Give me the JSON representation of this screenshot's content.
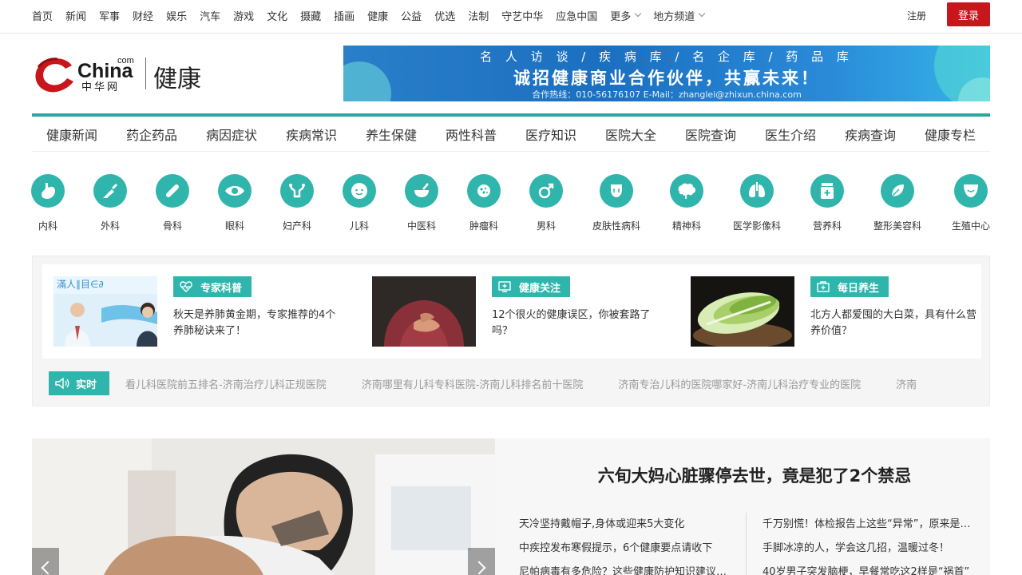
{
  "topnav": {
    "links": [
      "首页",
      "新闻",
      "军事",
      "财经",
      "娱乐",
      "汽车",
      "游戏",
      "文化",
      "摄藏",
      "插画",
      "健康",
      "公益",
      "优选",
      "法制",
      "守艺中华",
      "应急中国"
    ],
    "more": "更多",
    "local": "地方频道",
    "register": "注册",
    "login": "登录"
  },
  "logo": {
    "brand": "China",
    "com": "com",
    "cn": "中华网",
    "channel": "健康"
  },
  "banner": {
    "line1": "名 人 访 谈  /  疾 病 库  /  名 企 库  /  药 品 库",
    "line2": "诚招健康商业合作伙伴，共赢未来！",
    "line3": "合作热线：010-56176107    E-Mail：zhanglei@zhixun.china.com"
  },
  "channav": [
    "健康新闻",
    "药企药品",
    "病因症状",
    "疾病常识",
    "养生保健",
    "两性科普",
    "医疗知识",
    "医院大全",
    "医院查询",
    "医生介绍",
    "疾病查询",
    "健康专栏"
  ],
  "departments": [
    {
      "label": "内科",
      "icon": "stomach-icon"
    },
    {
      "label": "外科",
      "icon": "scalpel-icon"
    },
    {
      "label": "骨科",
      "icon": "bone-icon"
    },
    {
      "label": "眼科",
      "icon": "eye-icon"
    },
    {
      "label": "妇产科",
      "icon": "uterus-icon"
    },
    {
      "label": "儿科",
      "icon": "baby-icon"
    },
    {
      "label": "中医科",
      "icon": "mortar-icon"
    },
    {
      "label": "肿瘤科",
      "icon": "tumor-icon"
    },
    {
      "label": "男科",
      "icon": "male-icon"
    },
    {
      "label": "皮肤性病科",
      "icon": "skin-icon"
    },
    {
      "label": "精神科",
      "icon": "brain-icon"
    },
    {
      "label": "医学影像科",
      "icon": "lungs-icon"
    },
    {
      "label": "营养科",
      "icon": "supplement-icon"
    },
    {
      "label": "整形美容科",
      "icon": "leaf-icon"
    },
    {
      "label": "生殖中心",
      "icon": "reproductive-icon"
    }
  ],
  "features": [
    {
      "tag": "专家科普",
      "title": "秋天是养肺黄金期，专家推荐的4个养肺秘诀来了！",
      "icon": "heartbeat-icon"
    },
    {
      "tag": "健康关注",
      "title": "12个很火的健康误区，你被套路了吗？",
      "icon": "monitor-plus-icon"
    },
    {
      "tag": "每日养生",
      "title": "北方人都爱囤的大白菜，具有什么营养价值？",
      "icon": "first-aid-icon"
    }
  ],
  "realtime": {
    "label": "实时",
    "items": [
      "看儿科医院前五排名-济南治疗儿科正规医院",
      "济南哪里有儿科专科医院-济南儿科排名前十医院",
      "济南专治儿科的医院哪家好-济南儿科治疗专业的医院",
      "济南"
    ]
  },
  "hero": {
    "headline": "六旬大妈心脏骤停去世，竟是犯了2个禁忌",
    "left": [
      "天冷坚持戴帽子,身体或迎来5大变化",
      "中疾控发布寒假提示，6个健康要点请收下",
      "尼帕病毒有多危险？这些健康防护知识建议收藏"
    ],
    "right": [
      "千万别慌！体检报告上这些“异常”，原来是正常的",
      "手脚冰凉的人，学会这几招，温暖过冬！",
      "40岁男子突发脑梗，早餐常吃这2样是“祸首”"
    ]
  },
  "colors": {
    "accent": "#2fb5ac",
    "brand_red": "#c8161d",
    "banner_blue": "#1b6fc0"
  }
}
